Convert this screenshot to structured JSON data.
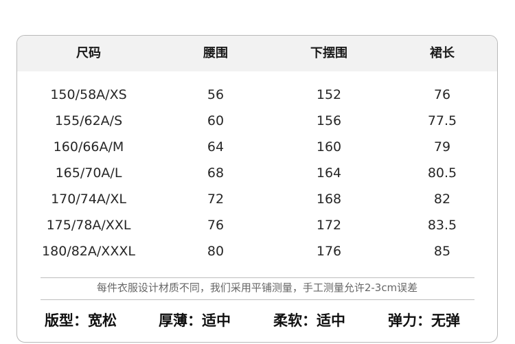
{
  "table": {
    "headers": [
      "尺码",
      "腰围",
      "下摆围",
      "裙长"
    ],
    "rows": [
      [
        "150/58A/XS",
        "56",
        "152",
        "76"
      ],
      [
        "155/62A/S",
        "60",
        "156",
        "77.5"
      ],
      [
        "160/66A/M",
        "64",
        "160",
        "79"
      ],
      [
        "165/70A/L",
        "68",
        "164",
        "80.5"
      ],
      [
        "170/74A/XL",
        "72",
        "168",
        "82"
      ],
      [
        "175/78A/XXL",
        "76",
        "172",
        "83.5"
      ],
      [
        "180/82A/XXXL",
        "80",
        "176",
        "85"
      ]
    ]
  },
  "note": "每件衣服设计材质不同，我们采用平铺测量，手工测量允许2-3cm误差",
  "attributes": [
    "版型：宽松",
    "厚薄：适中",
    "柔软：适中",
    "弹力：无弹"
  ]
}
